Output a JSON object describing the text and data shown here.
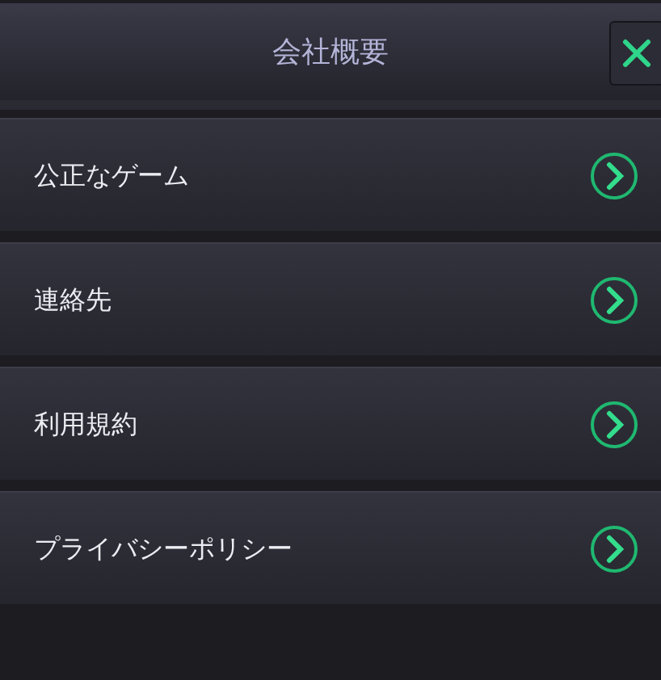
{
  "header": {
    "title": "会社概要"
  },
  "menu_items": [
    {
      "label": "公正なゲーム"
    },
    {
      "label": "連絡先"
    },
    {
      "label": "利用規約"
    },
    {
      "label": "プライバシーポリシー"
    }
  ]
}
